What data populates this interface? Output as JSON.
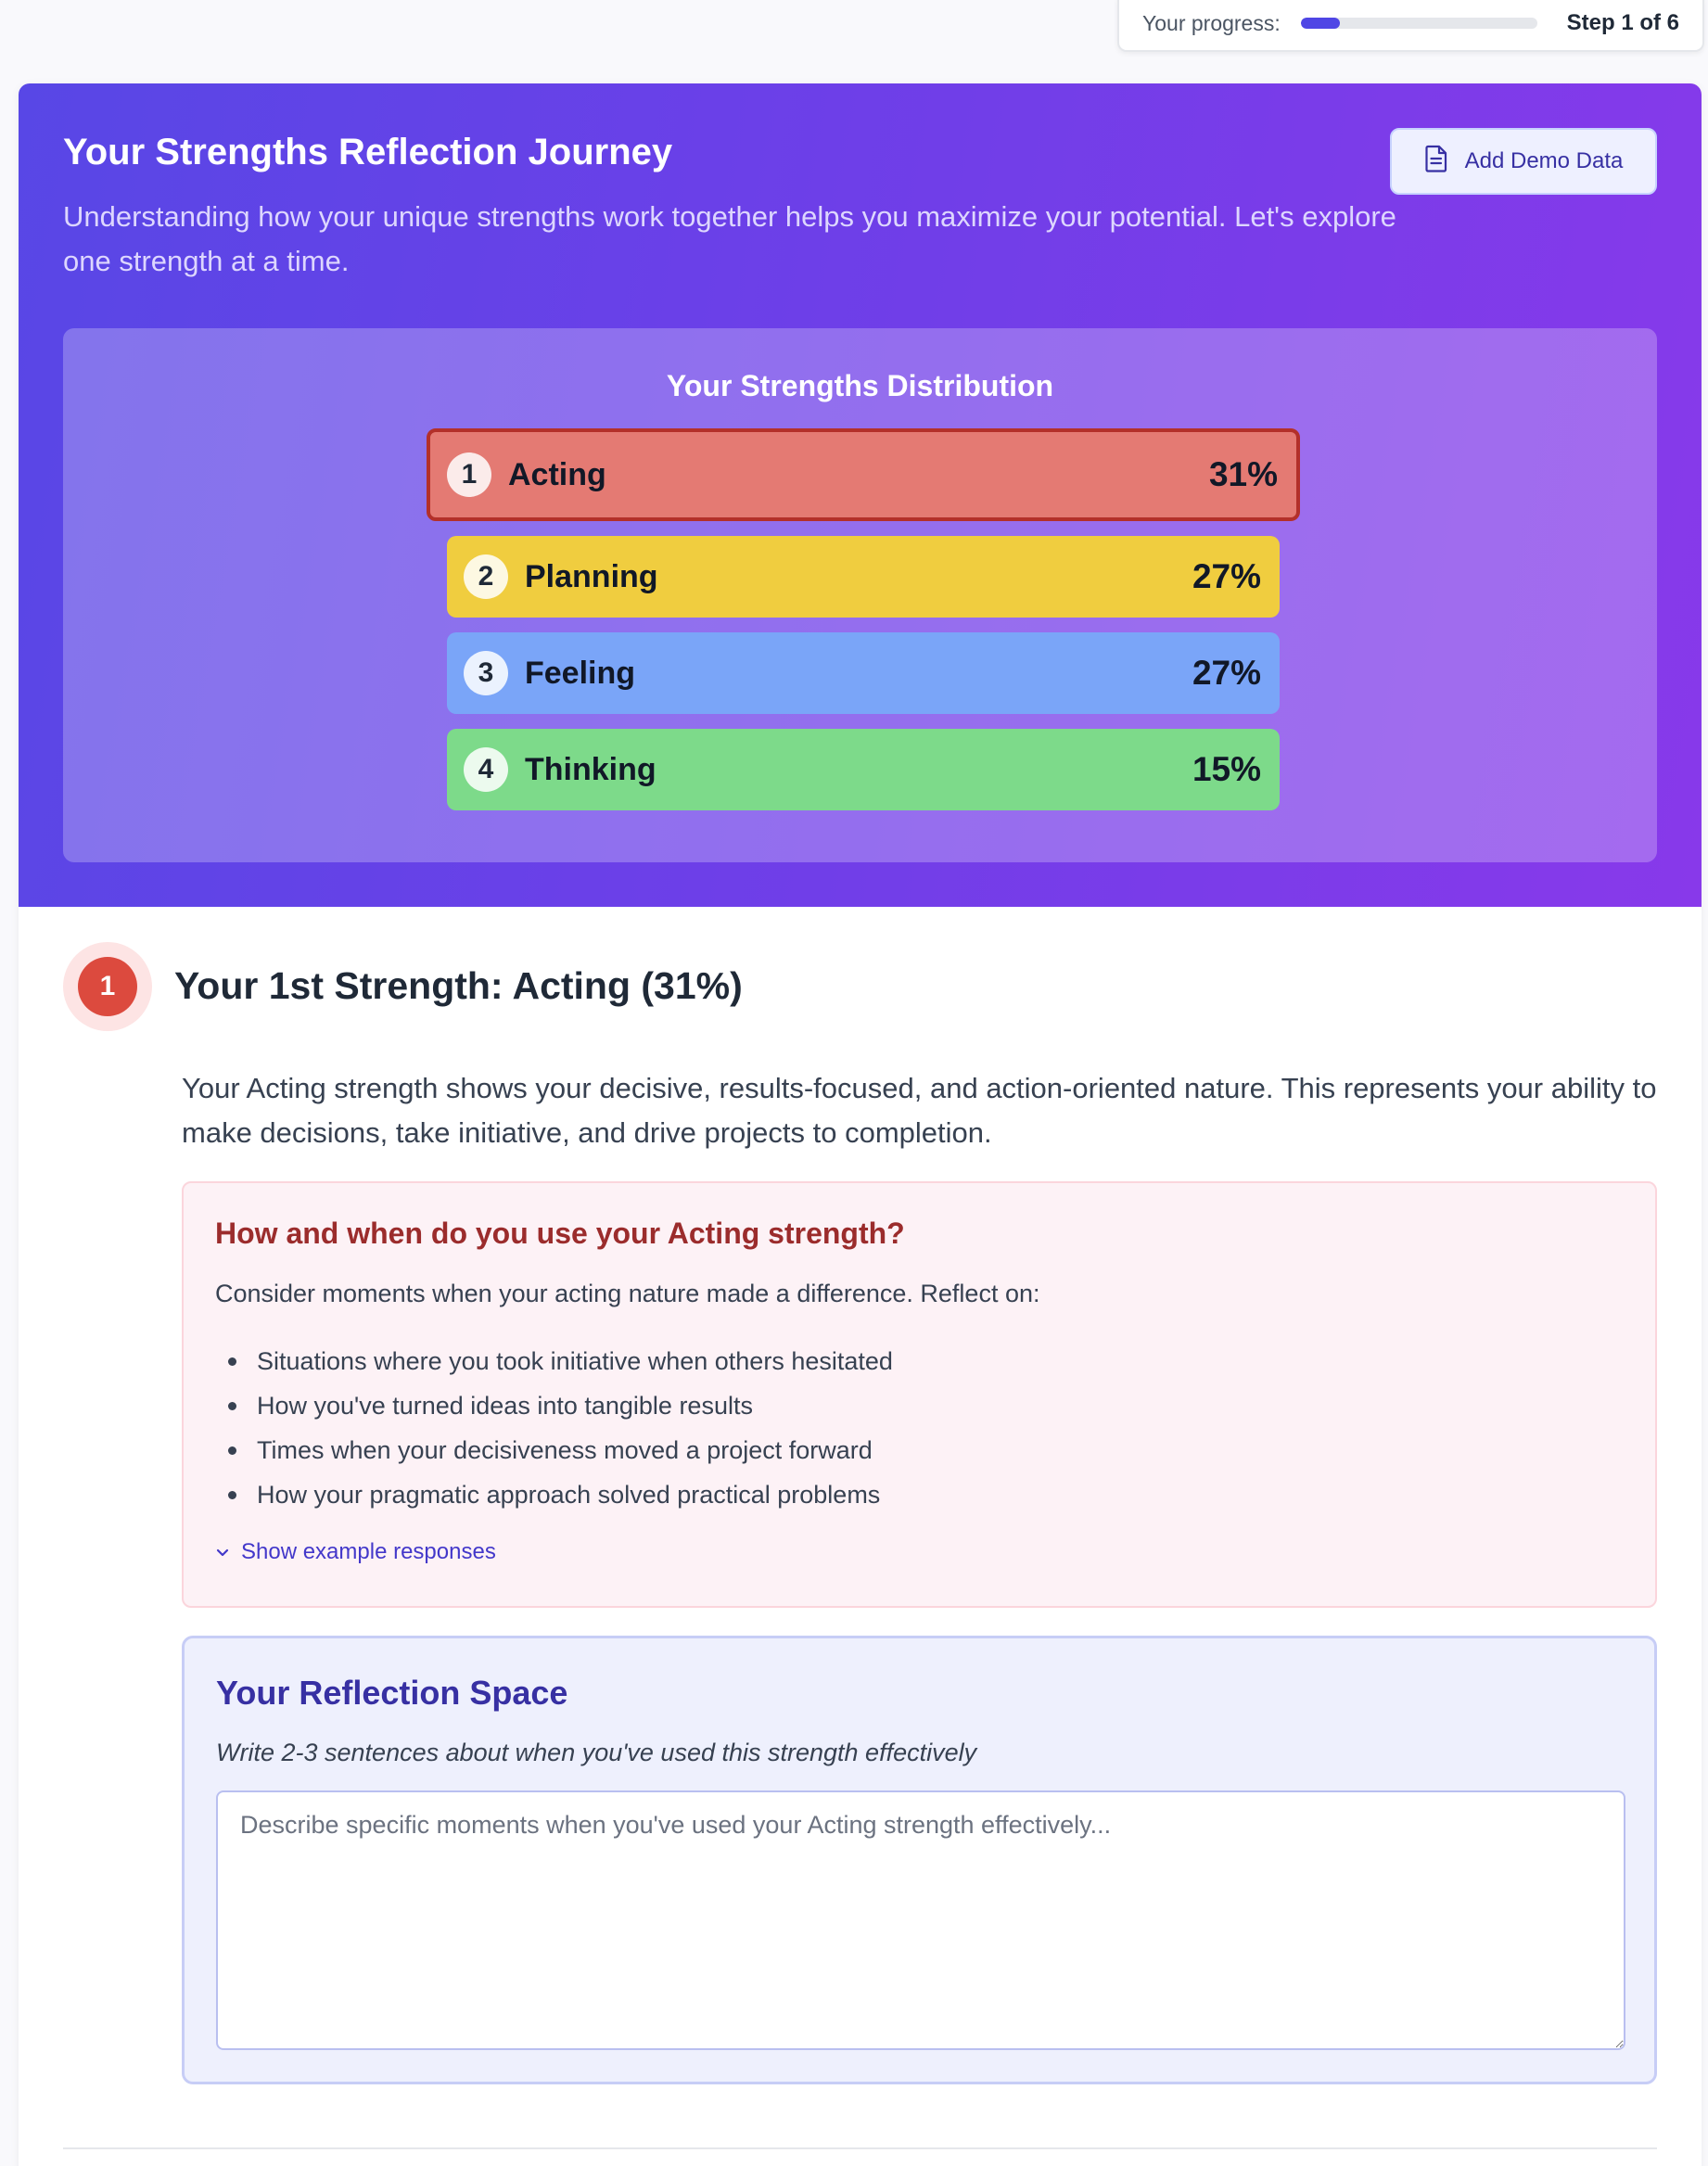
{
  "progress": {
    "label": "Your progress:",
    "value": 0.167,
    "step_text": "Step 1 of 6"
  },
  "header": {
    "title": "Your Strengths Reflection Journey",
    "subtitle": "Understanding how your unique strengths work together helps you maximize your potential. Let's explore one strength at a time.",
    "demo_button_label": "Add Demo Data",
    "demo_button_icon": "document-icon"
  },
  "distribution": {
    "title": "Your Strengths Distribution",
    "items": [
      {
        "rank": "1",
        "label": "Acting",
        "percent_text": "31%",
        "percent": 31,
        "color": "#e47a73",
        "active": true
      },
      {
        "rank": "2",
        "label": "Planning",
        "percent_text": "27%",
        "percent": 27,
        "color": "#f0cd3f",
        "active": false
      },
      {
        "rank": "3",
        "label": "Feeling",
        "percent_text": "27%",
        "percent": 27,
        "color": "#7aa5f8",
        "active": false
      },
      {
        "rank": "4",
        "label": "Thinking",
        "percent_text": "15%",
        "percent": 15,
        "color": "#7dda8a",
        "active": false
      }
    ]
  },
  "section": {
    "badge": "1",
    "heading": "Your 1st Strength: Acting (31%)",
    "description": "Your Acting strength shows your decisive, results-focused, and action-oriented nature. This represents your ability to make decisions, take initiative, and drive projects to completion."
  },
  "prompt": {
    "title": "How and when do you use your Acting strength?",
    "intro": "Consider moments when your acting nature made a difference. Reflect on:",
    "items": [
      "Situations where you took initiative when others hesitated",
      "How you've turned ideas into tangible results",
      "Times when your decisiveness moved a project forward",
      "How your pragmatic approach solved practical problems"
    ],
    "show_examples_label": "Show example responses",
    "show_examples_icon": "chevron-down-icon"
  },
  "reflection": {
    "title": "Your Reflection Space",
    "subtitle": "Write 2-3 sentences about when you've used this strength effectively",
    "placeholder": "Describe specific moments when you've used your Acting strength effectively...",
    "value": ""
  },
  "colors": {
    "accent": "#4f46e5",
    "header_gradient_start": "#5847e6",
    "header_gradient_end": "#8839ea",
    "badge_red": "#dc4a3e"
  }
}
